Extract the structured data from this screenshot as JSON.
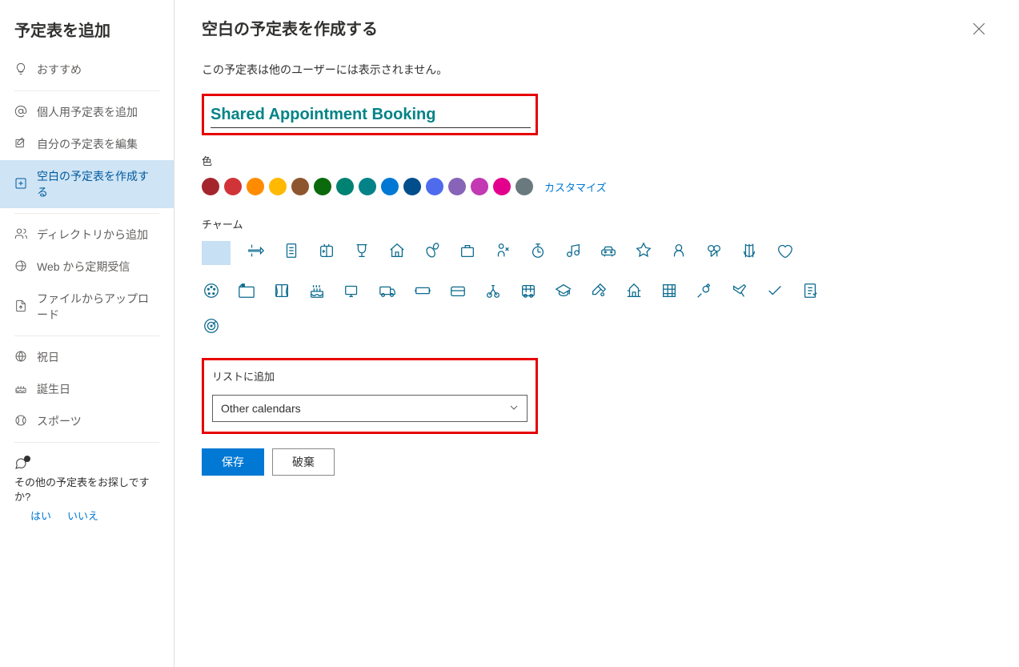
{
  "sidebar": {
    "title": "予定表を追加",
    "items": [
      {
        "label": "おすすめ",
        "icon": "lightbulb"
      },
      {
        "label": "個人用予定表を追加",
        "icon": "at"
      },
      {
        "label": "自分の予定表を編集",
        "icon": "edit"
      },
      {
        "label": "空白の予定表を作成する",
        "icon": "add-square",
        "active": true
      },
      {
        "label": "ディレクトリから追加",
        "icon": "people"
      },
      {
        "label": "Web から定期受信",
        "icon": "globe-sync"
      },
      {
        "label": "ファイルからアップロード",
        "icon": "upload"
      },
      {
        "label": "祝日",
        "icon": "globe"
      },
      {
        "label": "誕生日",
        "icon": "cake"
      },
      {
        "label": "スポーツ",
        "icon": "sports"
      }
    ],
    "footer": {
      "text": "その他の予定表をお探しですか?",
      "yes": "はい",
      "no": "いいえ"
    }
  },
  "main": {
    "title": "空白の予定表を作成する",
    "description": "この予定表は他のユーザーには表示されません。",
    "name_value": "Shared Appointment Booking",
    "color_label": "色",
    "customize": "カスタマイズ",
    "colors": [
      "#a4262c",
      "#d13438",
      "#ff8c00",
      "#ffb900",
      "#8e562e",
      "#0b6a0b",
      "#008272",
      "#038387",
      "#0078d4",
      "#004e8c",
      "#4f6bed",
      "#8764b8",
      "#c239b3",
      "#e3008c",
      "#69797e"
    ],
    "charm_label": "チャーム",
    "addtolist_label": "リストに追加",
    "dropdown_value": "Other calendars",
    "save": "保存",
    "discard": "破棄"
  }
}
